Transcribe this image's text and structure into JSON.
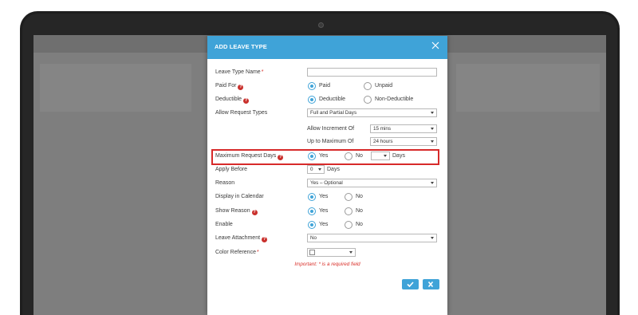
{
  "modal": {
    "title": "ADD LEAVE TYPE",
    "close_icon": "close-icon"
  },
  "fields": {
    "leave_type_name": {
      "label": "Leave Type Name",
      "required_mark": "*",
      "value": ""
    },
    "paid_for": {
      "label": "Paid For",
      "options": [
        "Paid",
        "Unpaid"
      ],
      "selected": "Paid"
    },
    "deductible": {
      "label": "Deductible",
      "options": [
        "Deductible",
        "Non-Deductible"
      ],
      "selected": "Deductible"
    },
    "allow_request_types": {
      "label": "Allow Request Types",
      "value": "Full and Partial Days"
    },
    "allow_increment_of": {
      "label": "Allow Increment Of",
      "value": "15 mins"
    },
    "up_to_maximum_of": {
      "label": "Up to Maximum Of",
      "value": "24 hours"
    },
    "maximum_request_days": {
      "label": "Maximum Request Days",
      "options": [
        "Yes",
        "No"
      ],
      "selected": "Yes",
      "days_value": "",
      "days_label": "Days"
    },
    "apply_before": {
      "label": "Apply Before",
      "value": "0",
      "unit": "Days"
    },
    "reason": {
      "label": "Reason",
      "value": "Yes – Optional"
    },
    "display_in_calendar": {
      "label": "Display in Calendar",
      "options": [
        "Yes",
        "No"
      ],
      "selected": "Yes"
    },
    "show_reason": {
      "label": "Show Reason",
      "options": [
        "Yes",
        "No"
      ],
      "selected": "Yes"
    },
    "enable": {
      "label": "Enable",
      "options": [
        "Yes",
        "No"
      ],
      "selected": "Yes"
    },
    "leave_attachment": {
      "label": "Leave Attachment",
      "value": "No"
    },
    "color_reference": {
      "label": "Color Reference",
      "required_mark": "*"
    }
  },
  "help_icon_text": "?",
  "note": "Important: * is a required field",
  "buttons": {
    "save": {
      "icon": "check-icon"
    },
    "cancel": {
      "icon": "x-icon"
    }
  },
  "colors": {
    "accent": "#3fa3d8",
    "highlight_border": "#d72a2a",
    "required": "#d9302a",
    "help_badge": "#c9302c"
  }
}
